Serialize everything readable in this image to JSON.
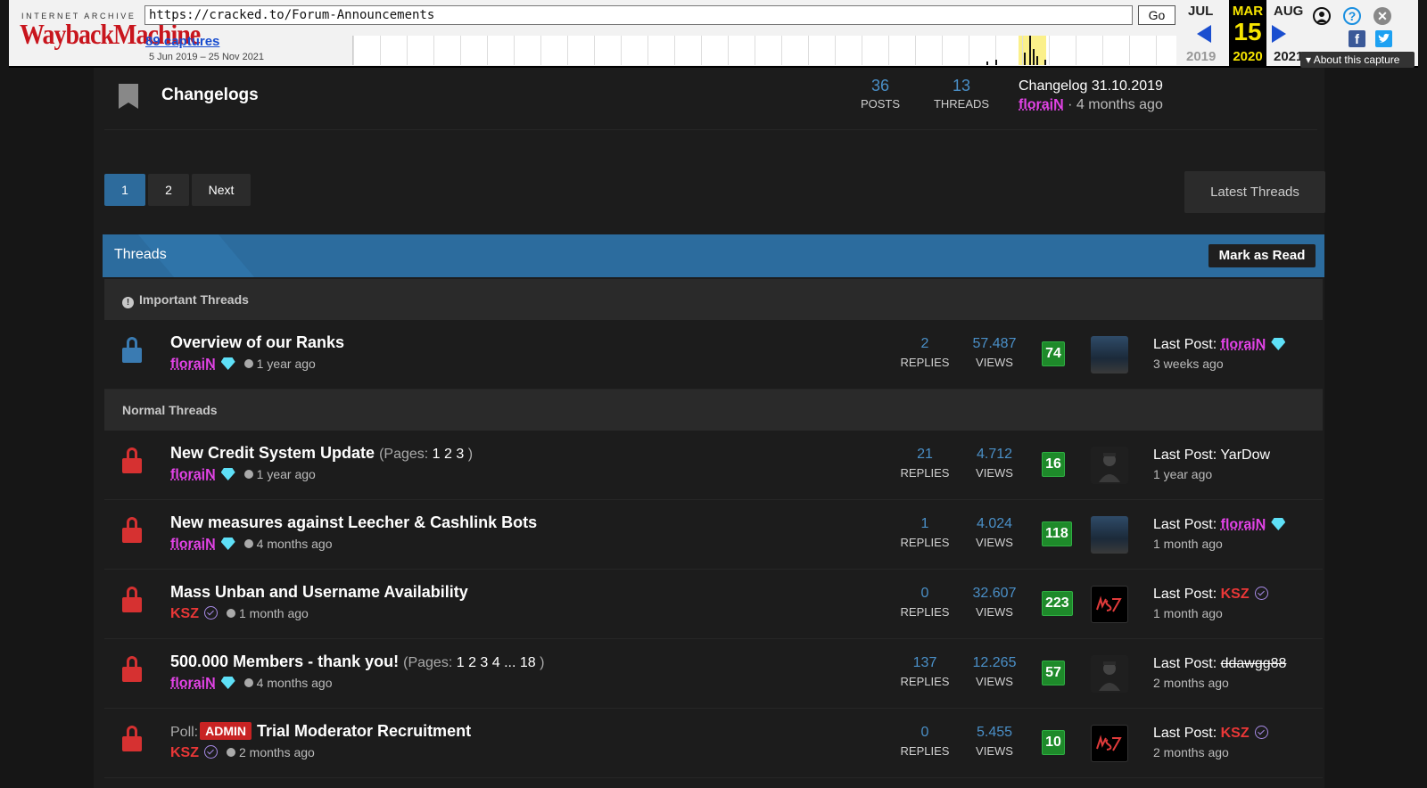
{
  "wayback": {
    "logo_top": "INTERNET ARCHIVE",
    "logo_main": "WaybackMachine",
    "url": "https://cracked.to/Forum-Announcements",
    "go_label": "Go",
    "captures": "89 captures",
    "range": "5 Jun 2019 – 25 Nov 2021",
    "prev_month": "JUL",
    "cur_month": "MAR",
    "next_month": "AUG",
    "cur_day": "15",
    "prev_year": "2019",
    "cur_year": "2020",
    "next_year": "2021",
    "about": "About this capture"
  },
  "changelogs": {
    "title": "Changelogs",
    "posts_num": "36",
    "posts_label": "POSTS",
    "threads_num": "13",
    "threads_label": "THREADS",
    "last_title": "Changelog 31.10.2019",
    "last_user": "floraiN",
    "last_time": "· 4 months ago"
  },
  "pagination": {
    "p1": "1",
    "p2": "2",
    "next": "Next",
    "latest": "Latest Threads"
  },
  "threads_header": {
    "label": "Threads",
    "mark_read": "Mark as Read"
  },
  "sections": {
    "important": "Important Threads",
    "normal": "Normal Threads"
  },
  "labels": {
    "replies": "REPLIES",
    "views": "VIEWS",
    "last_post": "Last Post:",
    "pages_open": "(Pages:",
    "pages_close": ")",
    "poll": "Poll:",
    "admin": "ADMIN"
  },
  "threads": [
    {
      "title": "Overview of our Ranks",
      "author": "floraiN",
      "time": "1 year ago",
      "replies": "2",
      "views": "57.487",
      "rating": "74",
      "last_user": "floraiN",
      "last_time": "3 weeks ago"
    },
    {
      "title": "New Credit System Update",
      "pages": "1 2 3",
      "author": "floraiN",
      "time": "1 year ago",
      "replies": "21",
      "views": "4.712",
      "rating": "16",
      "last_user": "YarDow",
      "last_time": "1 year ago"
    },
    {
      "title": "New measures against Leecher & Cashlink Bots",
      "author": "floraiN",
      "time": "4 months ago",
      "replies": "1",
      "views": "4.024",
      "rating": "118",
      "last_user": "floraiN",
      "last_time": "1 month ago"
    },
    {
      "title": "Mass Unban and Username Availability",
      "author": "KSZ",
      "time": "1 month ago",
      "replies": "0",
      "views": "32.607",
      "rating": "223",
      "last_user": "KSZ",
      "last_time": "1 month ago"
    },
    {
      "title": "500.000 Members - thank you!",
      "pages": "1 2 3 4 ... 18",
      "author": "floraiN",
      "time": "4 months ago",
      "replies": "137",
      "views": "12.265",
      "rating": "57",
      "last_user": "ddawgg88",
      "last_time": "2 months ago"
    },
    {
      "title": "Trial Moderator Recruitment",
      "author": "KSZ",
      "time": "2 months ago",
      "replies": "0",
      "views": "5.455",
      "rating": "10",
      "last_user": "KSZ",
      "last_time": "2 months ago"
    }
  ],
  "colors": {
    "accent": "#2c6c9e",
    "rating_green": "#1e8a2a",
    "pink_user": "#e243e6",
    "red_user": "#ea3737",
    "lock_red": "#d63131",
    "lock_blue": "#3a7bb2"
  }
}
